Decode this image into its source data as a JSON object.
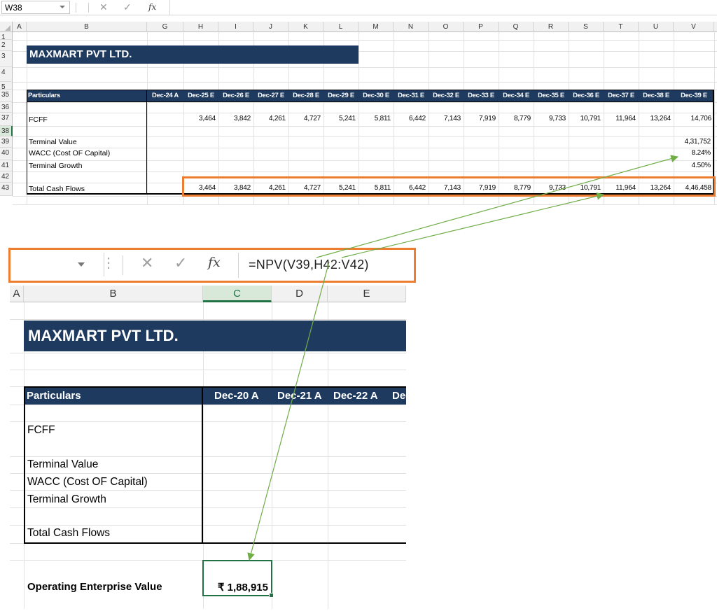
{
  "top": {
    "name_box": "W38",
    "fx_label": "fx",
    "columns": [
      "A",
      "B",
      "G",
      "H",
      "I",
      "J",
      "K",
      "L",
      "M",
      "N",
      "O",
      "P",
      "Q",
      "R",
      "S",
      "T",
      "U",
      "V"
    ],
    "rows": [
      "1",
      "2",
      "3",
      "4",
      "5",
      "35",
      "36",
      "37",
      "38",
      "39",
      "40",
      "41",
      "42",
      "43"
    ],
    "company": "MAXMART PVT LTD.",
    "particulars": "Particulars",
    "periods": [
      "Dec-24 A",
      "Dec-25 E",
      "Dec-26 E",
      "Dec-27 E",
      "Dec-28 E",
      "Dec-29 E",
      "Dec-30 E",
      "Dec-31 E",
      "Dec-32 E",
      "Dec-33 E",
      "Dec-34 E",
      "Dec-35 E",
      "Dec-36 E",
      "Dec-37 E",
      "Dec-38 E",
      "Dec-39 E"
    ],
    "labels": {
      "fcff": "FCFF",
      "terminal_value": "Terminal Value",
      "wacc": "WACC (Cost OF Capital)",
      "terminal_growth": "Terminal Growth",
      "total_cash_flows": "Total Cash Flows"
    },
    "fcff": [
      "3,464",
      "3,842",
      "4,261",
      "4,727",
      "5,241",
      "5,811",
      "6,442",
      "7,143",
      "7,919",
      "8,779",
      "9,733",
      "10,791",
      "11,964",
      "13,264",
      "14,706"
    ],
    "terminal_value": "4,31,752",
    "wacc": "8.24%",
    "terminal_growth": "4.50%",
    "total_cash_flows": [
      "3,464",
      "3,842",
      "4,261",
      "4,727",
      "5,241",
      "5,811",
      "6,442",
      "7,143",
      "7,919",
      "8,779",
      "9,733",
      "10,791",
      "11,964",
      "13,264",
      "4,46,458"
    ]
  },
  "zoom": {
    "formula": "=NPV(V39,H42:V42)",
    "fx_label": "fx",
    "columns": [
      "A",
      "B",
      "C",
      "D",
      "E"
    ],
    "company": "MAXMART PVT LTD.",
    "particulars": "Particulars",
    "periods": [
      "Dec-20 A",
      "Dec-21 A",
      "Dec-22 A",
      "Dec"
    ],
    "labels": {
      "fcff": "FCFF",
      "terminal_value": "Terminal Value",
      "wacc": "WACC (Cost OF Capital)",
      "terminal_growth": "Terminal Growth",
      "total_cash_flows": "Total Cash Flows"
    },
    "operating_ev_label": "Operating Enterprise Value",
    "operating_ev_value": "₹ 1,88,915"
  },
  "colors": {
    "header_fill": "#1f3a5f",
    "highlight": "#ed7d31",
    "arrow": "#70ad47",
    "selection": "#217346"
  }
}
